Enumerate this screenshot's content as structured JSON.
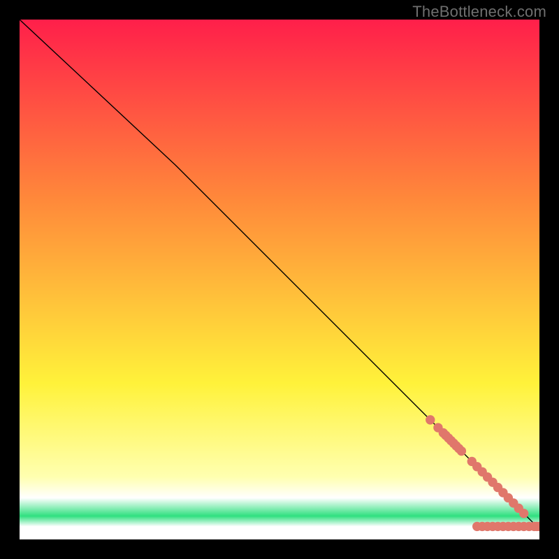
{
  "watermark": "TheBottleneck.com",
  "colors": {
    "frame_bg": "#000000",
    "line": "#000000",
    "marker_fill": "#e0776b",
    "top_grad": "#ff1f4a",
    "mid_warm": "#ff8a3a",
    "mid_yellow": "#fff23a",
    "pale_yellow": "#ffffb0",
    "green": "#2fe07f",
    "white": "#ffffff"
  },
  "chart_data": {
    "type": "line",
    "title": "",
    "xlabel": "",
    "ylabel": "",
    "xlim": [
      0,
      100
    ],
    "ylim": [
      0,
      100
    ],
    "series": [
      {
        "name": "curve",
        "x": [
          0,
          30,
          100
        ],
        "y": [
          100,
          72,
          2
        ]
      }
    ],
    "markers": {
      "name": "highlighted-points",
      "x": [
        79,
        80.5,
        81.5,
        82,
        82.5,
        83,
        83.5,
        84,
        84.5,
        85,
        87,
        88,
        89,
        90,
        91,
        92,
        93,
        94,
        95,
        96,
        97,
        99.5
      ],
      "y": [
        23,
        21.5,
        20.5,
        20,
        19.5,
        19,
        18.5,
        18,
        17.5,
        17,
        15,
        14,
        13,
        12,
        11,
        10,
        9,
        8,
        7,
        6,
        5,
        2.5
      ],
      "flat_x": [
        88,
        89,
        90,
        91,
        92,
        93,
        94,
        95,
        96,
        97,
        98,
        99,
        100
      ],
      "flat_y": [
        2.5,
        2.5,
        2.5,
        2.5,
        2.5,
        2.5,
        2.5,
        2.5,
        2.5,
        2.5,
        2.5,
        2.5,
        2.5
      ]
    }
  }
}
